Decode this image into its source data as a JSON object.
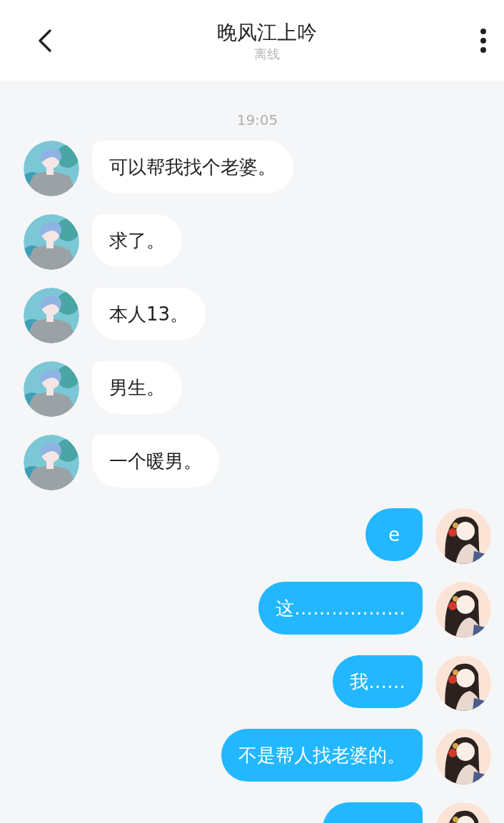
{
  "header": {
    "title": "晚风江上吟",
    "status": "离线"
  },
  "timestamp": "19:05",
  "messages": [
    {
      "kind": "incoming",
      "text": "可以帮我找个老婆。"
    },
    {
      "kind": "incoming",
      "text": "求了。"
    },
    {
      "kind": "incoming",
      "text": "本人13。"
    },
    {
      "kind": "incoming",
      "text": "男生。"
    },
    {
      "kind": "incoming",
      "text": "一个暖男。"
    },
    {
      "kind": "outgoing",
      "text": "e"
    },
    {
      "kind": "outgoing",
      "text": "这………………"
    },
    {
      "kind": "outgoing",
      "text": "我……"
    },
    {
      "kind": "outgoing",
      "text": "不是帮人找老婆的。"
    },
    {
      "kind": "outgoing"
    }
  ]
}
